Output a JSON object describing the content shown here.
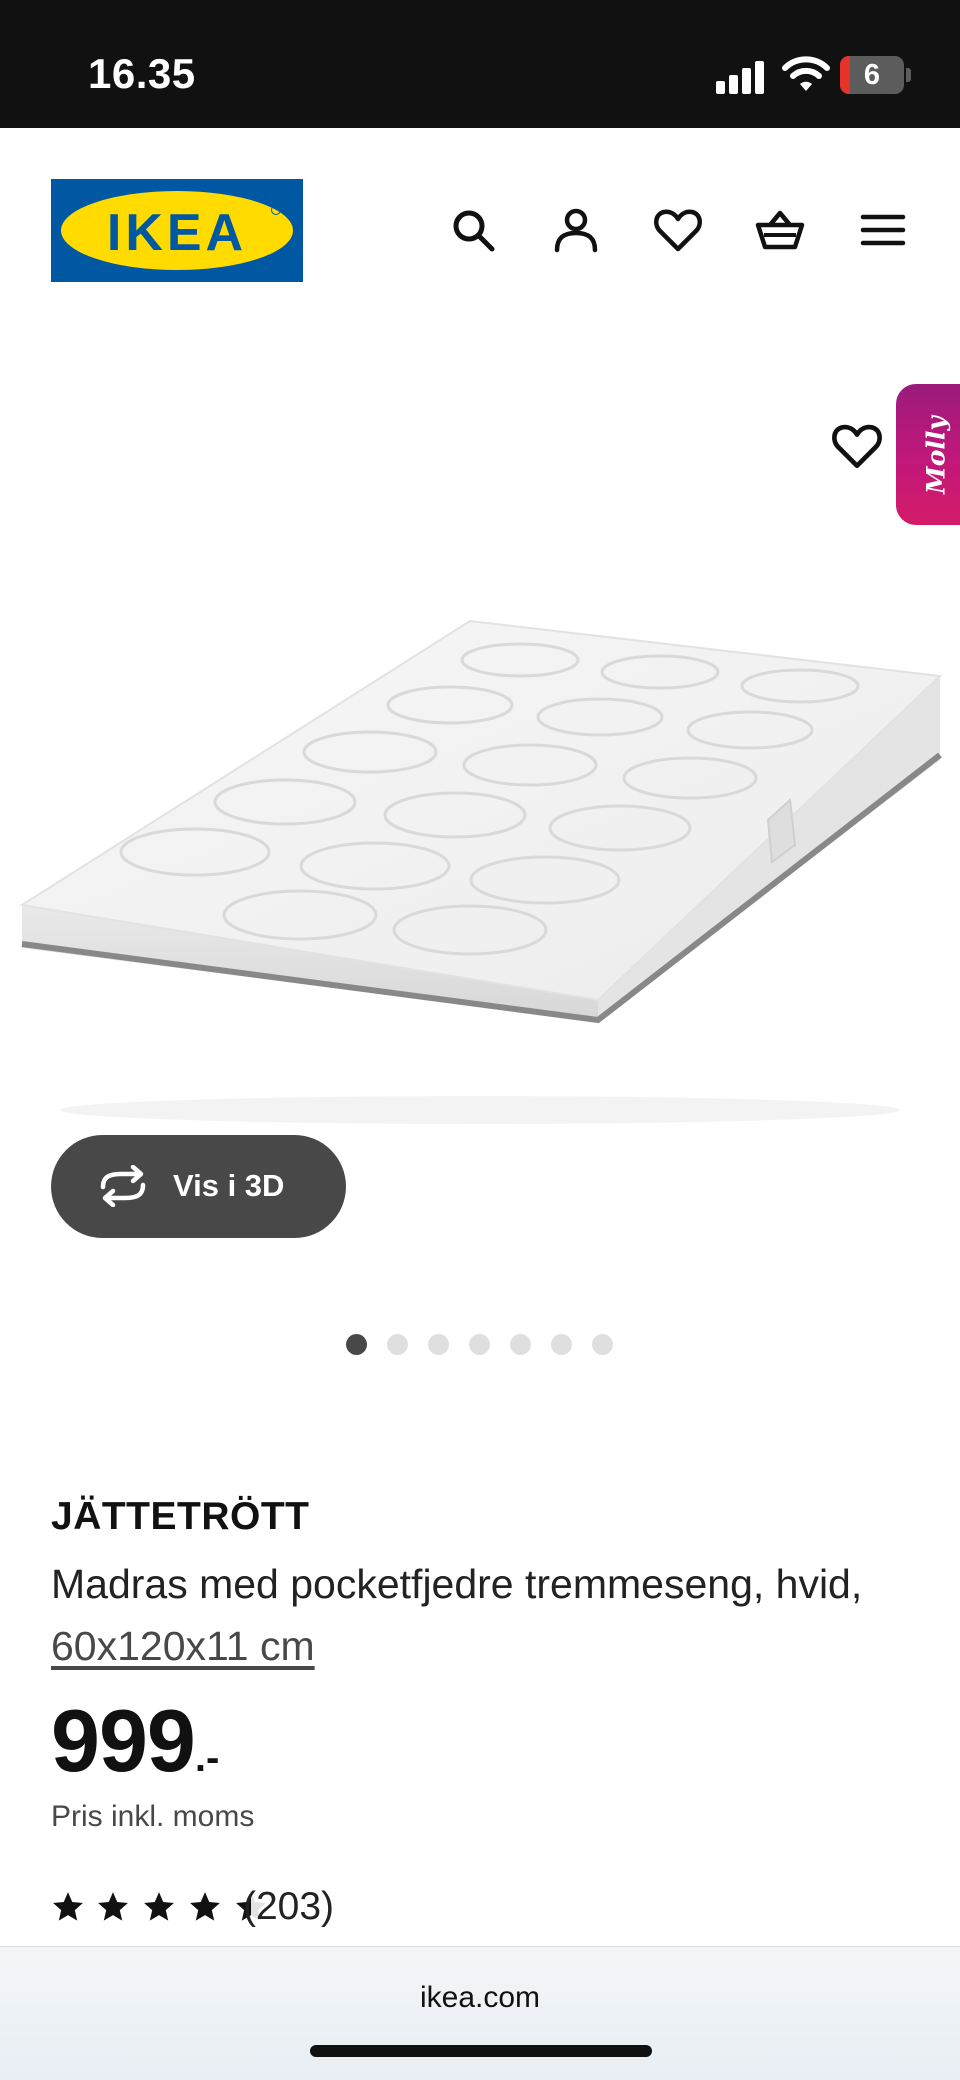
{
  "status_bar": {
    "time": "16.35",
    "battery_level": "6"
  },
  "header": {
    "logo_text": "IKEA",
    "icons": [
      "search-icon",
      "account-icon",
      "heart-icon",
      "basket-icon",
      "menu-icon"
    ]
  },
  "gallery": {
    "view_3d_label": "Vis i 3D",
    "assistant_label": "Molly",
    "image_count": 7,
    "active_image": 1
  },
  "product": {
    "name": "JÄTTETRÖTT",
    "description": "Madras med pocketfjedre tremmeseng, hvid,",
    "size": "60x120x11 cm",
    "price_integer": "999",
    "price_suffix": ".-",
    "price_note": "Pris inkl. moms",
    "rating": 4.5,
    "review_count": "(203)"
  },
  "browser": {
    "url": "ikea.com"
  },
  "colors": {
    "brand_blue": "#0058a3",
    "brand_yellow": "#ffdb00",
    "button_dark": "#484848",
    "assistant_gradient_start": "#9b1a7c",
    "assistant_gradient_end": "#d41b68"
  }
}
